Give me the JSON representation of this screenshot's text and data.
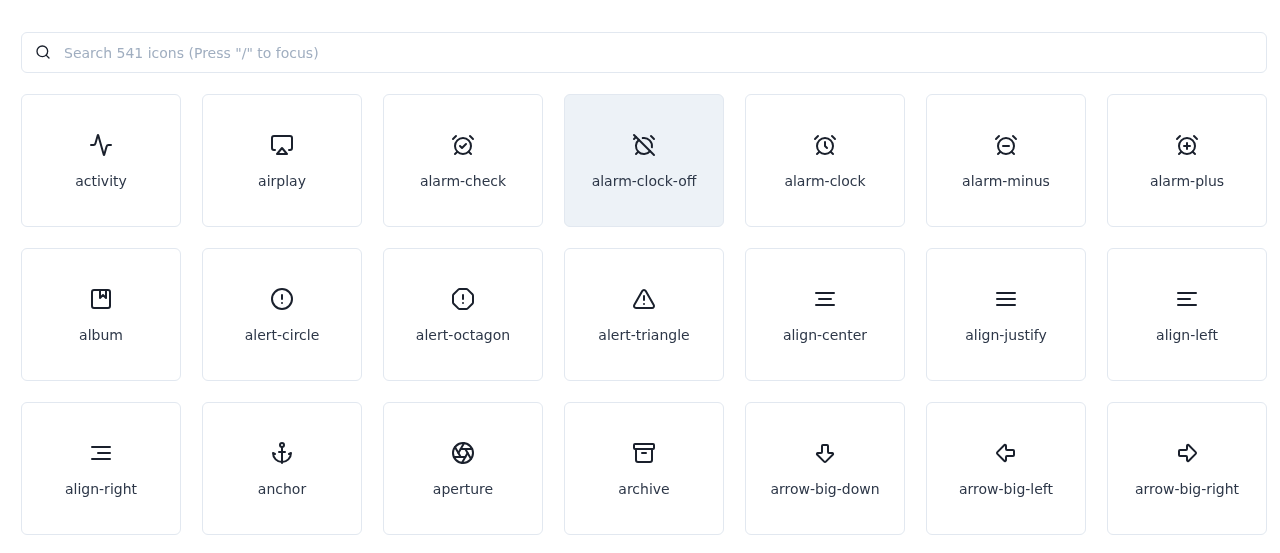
{
  "search": {
    "placeholder": "Search 541 icons (Press \"/\" to focus)"
  },
  "icons": [
    {
      "label": "activity",
      "selected": false
    },
    {
      "label": "airplay",
      "selected": false
    },
    {
      "label": "alarm-check",
      "selected": false
    },
    {
      "label": "alarm-clock-off",
      "selected": true
    },
    {
      "label": "alarm-clock",
      "selected": false
    },
    {
      "label": "alarm-minus",
      "selected": false
    },
    {
      "label": "alarm-plus",
      "selected": false
    },
    {
      "label": "album",
      "selected": false
    },
    {
      "label": "alert-circle",
      "selected": false
    },
    {
      "label": "alert-octagon",
      "selected": false
    },
    {
      "label": "alert-triangle",
      "selected": false
    },
    {
      "label": "align-center",
      "selected": false
    },
    {
      "label": "align-justify",
      "selected": false
    },
    {
      "label": "align-left",
      "selected": false
    },
    {
      "label": "align-right",
      "selected": false
    },
    {
      "label": "anchor",
      "selected": false
    },
    {
      "label": "aperture",
      "selected": false
    },
    {
      "label": "archive",
      "selected": false
    },
    {
      "label": "arrow-big-down",
      "selected": false
    },
    {
      "label": "arrow-big-left",
      "selected": false
    },
    {
      "label": "arrow-big-right",
      "selected": false
    }
  ]
}
